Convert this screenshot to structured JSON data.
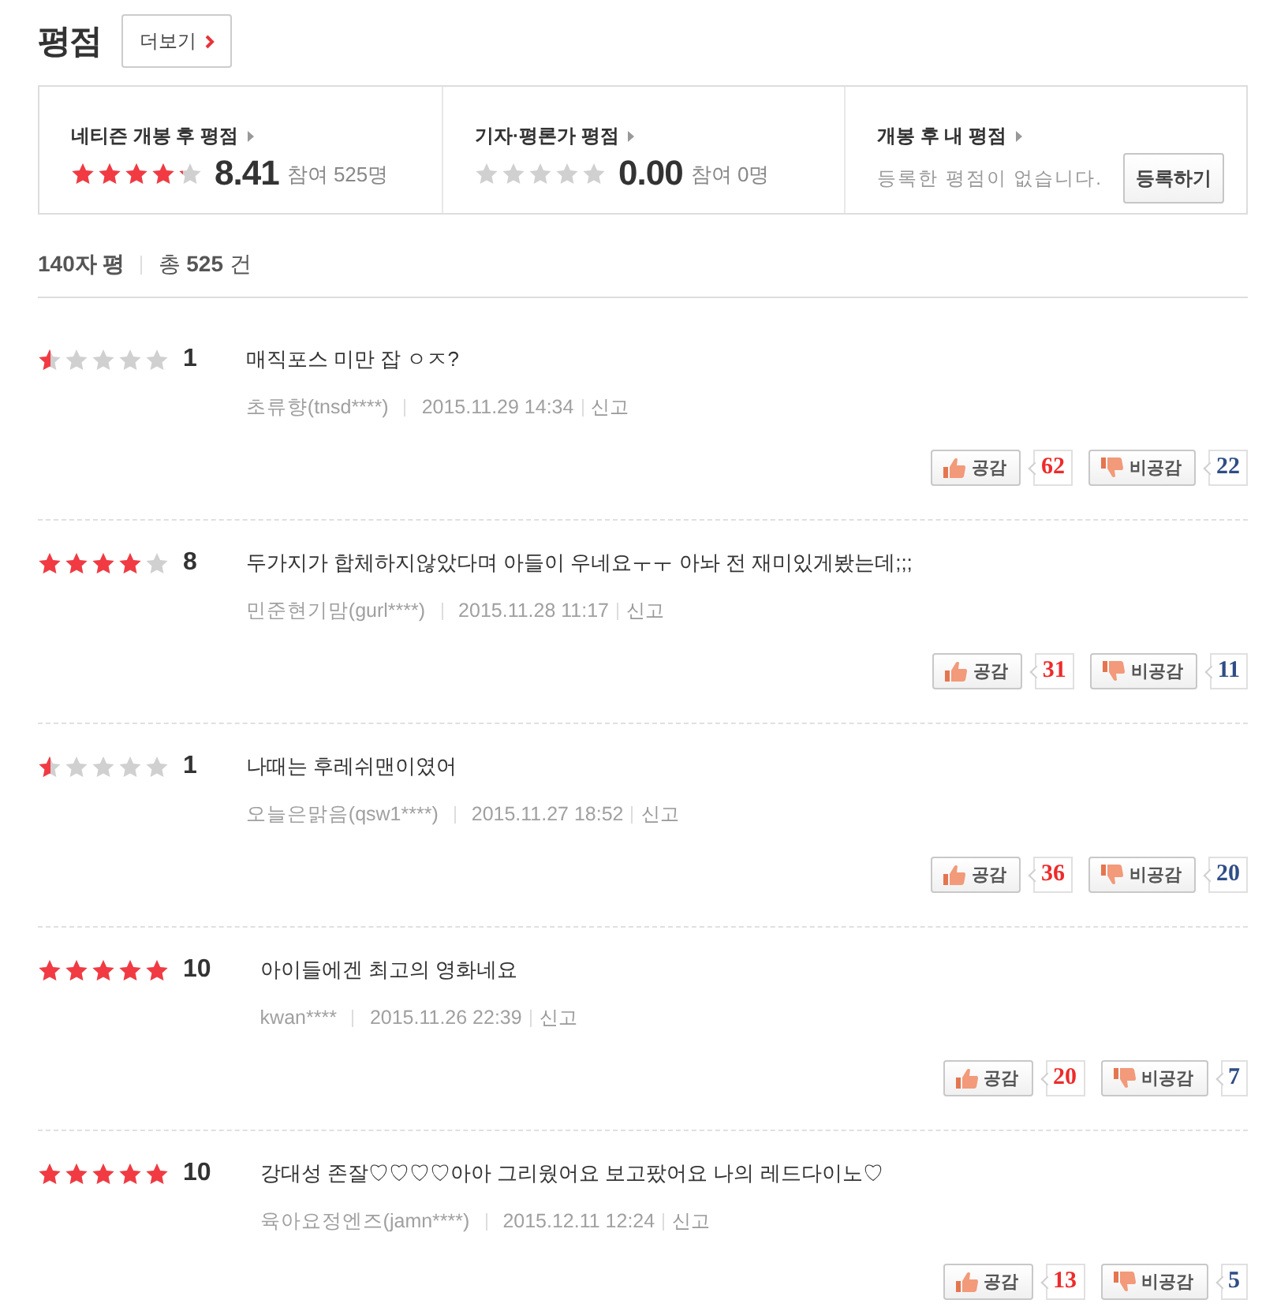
{
  "header": {
    "title": "평점",
    "more_button": "더보기"
  },
  "summary": [
    {
      "kind": "score",
      "title": "네티즌 개봉 후 평점",
      "stars": 4.2,
      "score": "8.41",
      "participants": "참여 525명"
    },
    {
      "kind": "score",
      "title": "기자·평론가 평점",
      "stars": 0,
      "score": "0.00",
      "participants": "참여 0명"
    },
    {
      "kind": "mine",
      "title": "개봉 후 내 평점",
      "message": "등록한 평점이 없습니다.",
      "button": "등록하기"
    }
  ],
  "list_header": {
    "title": "140자 평",
    "total": "총 **525** 건"
  },
  "reviews": [
    {
      "stars": 0.5,
      "score": "1",
      "comment": "매직포스 미만 잡 ㅇㅈ?",
      "author": "초류향(tnsd****)",
      "date": "2015.11.29 14:34",
      "report": "신고",
      "agree_label": "공감",
      "agree_count": "62",
      "disagree_label": "비공감",
      "disagree_count": "22"
    },
    {
      "stars": 4,
      "score": "8",
      "comment": "두가지가 합체하지않았다며 아들이 우네요ㅜㅜ 아놔 전 재미있게봤는데;;;",
      "author": "민준현기맘(gurl****)",
      "date": "2015.11.28 11:17",
      "report": "신고",
      "agree_label": "공감",
      "agree_count": "31",
      "disagree_label": "비공감",
      "disagree_count": "11"
    },
    {
      "stars": 0.5,
      "score": "1",
      "comment": "나때는 후레쉬맨이였어",
      "author": "오늘은맑음(qsw1****)",
      "date": "2015.11.27 18:52",
      "report": "신고",
      "agree_label": "공감",
      "agree_count": "36",
      "disagree_label": "비공감",
      "disagree_count": "20"
    },
    {
      "stars": 5,
      "score": "10",
      "comment": "아이들에겐 최고의 영화네요",
      "author": "kwan****",
      "date": "2015.11.26 22:39",
      "report": "신고",
      "agree_label": "공감",
      "agree_count": "20",
      "disagree_label": "비공감",
      "disagree_count": "7"
    },
    {
      "stars": 5,
      "score": "10",
      "comment": "강대성 존잘♡♡♡♡아아 그리웠어요 보고팠어요 나의 레드다이노♡",
      "author": "육아요정엔즈(jamn****)",
      "date": "2015.12.11 12:24",
      "report": "신고",
      "agree_label": "공감",
      "agree_count": "13",
      "disagree_label": "비공감",
      "disagree_count": "5"
    }
  ]
}
